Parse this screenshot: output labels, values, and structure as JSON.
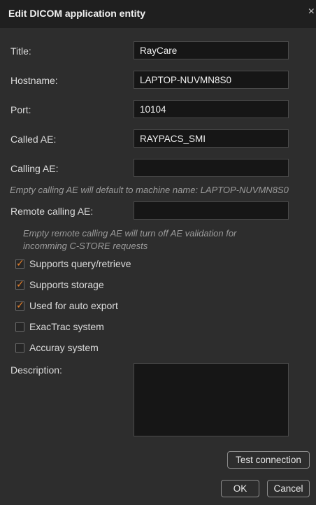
{
  "dialog": {
    "title": "Edit DICOM application entity",
    "close_glyph": "×"
  },
  "fields": {
    "title": {
      "label": "Title:",
      "value": "RayCare"
    },
    "hostname": {
      "label": "Hostname:",
      "value": "LAPTOP-NUVMN8S0"
    },
    "port": {
      "label": "Port:",
      "value": "10104"
    },
    "called_ae": {
      "label": "Called AE:",
      "value": "RAYPACS_SMI"
    },
    "calling_ae": {
      "label": "Calling AE:",
      "value": ""
    },
    "remote_calling_ae": {
      "label": "Remote calling AE:",
      "value": ""
    }
  },
  "hints": {
    "calling_ae": "Empty calling AE will default to machine name: LAPTOP-NUVMN8S0",
    "remote_line1": "Empty remote calling AE will turn off AE validation for",
    "remote_line2": "incomming C-STORE requests"
  },
  "checkboxes": [
    {
      "label": "Supports query/retrieve",
      "checked": true
    },
    {
      "label": "Supports storage",
      "checked": true
    },
    {
      "label": "Used for auto export",
      "checked": true
    },
    {
      "label": "ExacTrac system",
      "checked": false
    },
    {
      "label": "Accuray system",
      "checked": false
    }
  ],
  "description": {
    "label": "Description:",
    "value": ""
  },
  "buttons": {
    "test_connection": "Test connection",
    "ok": "OK",
    "cancel": "Cancel"
  },
  "colors": {
    "background": "#2d2d2d",
    "titlebar": "#1f1f1f",
    "input_background": "#161616",
    "check_accent": "#e8812a"
  },
  "icons": {
    "close": "close-icon",
    "check": "checkmark-icon"
  }
}
